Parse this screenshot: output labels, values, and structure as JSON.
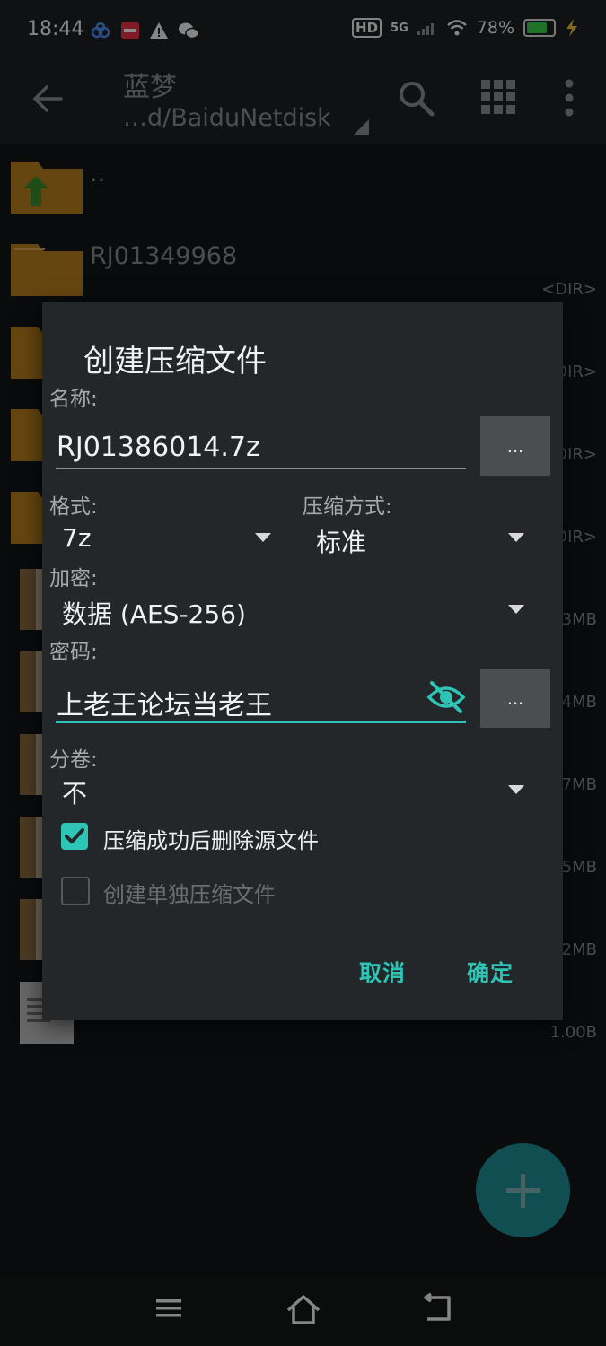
{
  "status_bar": {
    "time": "18:44",
    "right_text": {
      "hd": "HD",
      "net": "5G",
      "battery": "78%"
    },
    "icons_left": [
      "cloud-sync-icon",
      "app-notification-icon",
      "warning-icon",
      "wechat-icon"
    ],
    "icons_right": [
      "hd-icon",
      "signal-5g-icon",
      "signal-icon",
      "wifi-icon",
      "battery-icon",
      "charging-icon"
    ],
    "battery_level": 0.78,
    "colors": {
      "battery_fill": "#3ad14b"
    }
  },
  "app_bar": {
    "title": "蓝梦",
    "path": "…d/BaiduNetdisk",
    "icons": [
      "back-arrow-icon",
      "search-icon",
      "grid-view-icon",
      "more-vert-icon"
    ]
  },
  "file_list": {
    "items": [
      {
        "name": "..",
        "meta": "",
        "icon": "folder-up-icon"
      },
      {
        "name": "RJ01349968",
        "meta": "<DIR>",
        "icon": "folder-icon"
      },
      {
        "name": "",
        "meta": "DIR>",
        "icon": "folder-icon"
      },
      {
        "name": "",
        "meta": "DIR>",
        "icon": "folder-icon"
      },
      {
        "name": "",
        "meta": "DIR>",
        "icon": "folder-icon"
      },
      {
        "name": "",
        "meta": "3MB",
        "icon": "archive-7z-icon"
      },
      {
        "name": "",
        "meta": "4MB",
        "icon": "archive-7z-icon"
      },
      {
        "name": "",
        "meta": "7MB",
        "icon": "archive-zip-icon"
      },
      {
        "name": "",
        "meta": "5MB",
        "icon": "archive-zip-icon"
      },
      {
        "name": "",
        "meta": "2MB",
        "icon": "archive-7z-icon"
      },
      {
        "name": "",
        "meta": "1.00B",
        "icon": "text-file-icon"
      }
    ]
  },
  "dialog": {
    "title": "创建压缩文件",
    "name_label": "名称:",
    "name_value": "RJ01386014.7z",
    "browse_label": "...",
    "format_label": "格式:",
    "format_value": "7z",
    "method_label": "压缩方式:",
    "method_value": "标准",
    "encrypt_label": "加密:",
    "encrypt_value": "数据 (AES-256)",
    "password_label": "密码:",
    "password_value": "上老王论坛当老王",
    "password_browse_label": "...",
    "split_label": "分卷:",
    "split_value": "不",
    "delete_source": {
      "label": "压缩成功后删除源文件",
      "checked": true
    },
    "separate_archives": {
      "label": "创建单独压缩文件",
      "checked": false
    },
    "cancel_label": "取消",
    "ok_label": "确定",
    "colors": {
      "accent": "#2ec4b6",
      "surface": "#24272a"
    }
  },
  "fab": {
    "icon": "plus-icon",
    "color": "#1f8f95"
  },
  "nav_bar": {
    "icons": [
      "menu-icon",
      "home-icon",
      "back-icon"
    ]
  }
}
